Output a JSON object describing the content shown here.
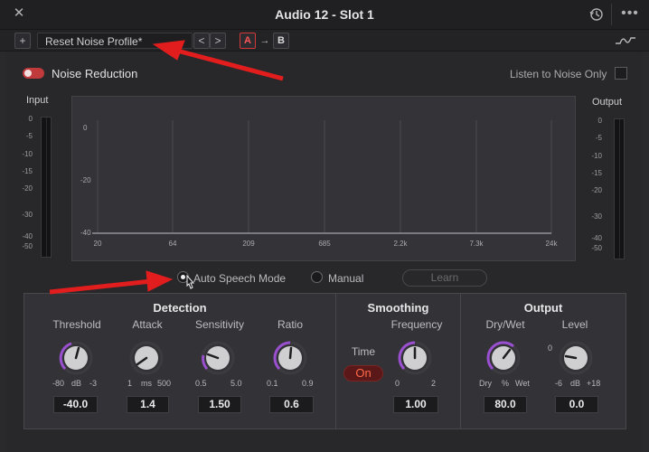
{
  "window": {
    "title": "Audio 12 - Slot 1"
  },
  "titlebar": {
    "close": "✕",
    "more": "•••"
  },
  "toolbar": {
    "add": "+",
    "preset": "Reset Noise Profile*",
    "preset_chevron": "⌄",
    "prev": "<",
    "next": ">",
    "a_label": "A",
    "copy_arrow": "→",
    "b_label": "B"
  },
  "header": {
    "noise_reduction": "Noise Reduction",
    "listen_to_noise_only": "Listen to Noise Only"
  },
  "meters": {
    "input_title": "Input",
    "output_title": "Output",
    "scale": [
      "0",
      "-5",
      "-10",
      "-15",
      "-20",
      "-30",
      "-40",
      "-50"
    ]
  },
  "graph": {
    "y_labels": [
      "0",
      "-20",
      "-40"
    ],
    "x_labels": [
      "20",
      "64",
      "209",
      "685",
      "2.2k",
      "7.3k",
      "24k"
    ]
  },
  "modes": {
    "auto_speech": "Auto Speech Mode",
    "manual": "Manual",
    "learn": "Learn",
    "selected": "auto_speech"
  },
  "detection": {
    "title": "Detection",
    "threshold": {
      "label": "Threshold",
      "min": "-80",
      "unit": "dB",
      "max": "-3",
      "value": "-40.0"
    },
    "attack": {
      "label": "Attack",
      "min": "1",
      "unit": "ms",
      "max": "500",
      "value": "1.4"
    },
    "sensitivity": {
      "label": "Sensitivity",
      "min": "0.5",
      "max": "5.0",
      "value": "1.50"
    },
    "ratio": {
      "label": "Ratio",
      "min": "0.1",
      "max": "0.9",
      "value": "0.6"
    }
  },
  "smoothing": {
    "title": "Smoothing",
    "time_label": "Time",
    "time_state": "On",
    "frequency": {
      "label": "Frequency",
      "min": "0",
      "max": "2",
      "value": "1.00"
    }
  },
  "output": {
    "title": "Output",
    "drywet": {
      "label": "Dry/Wet",
      "min": "Dry",
      "unit": "%",
      "max": "Wet",
      "value": "80.0"
    },
    "level": {
      "label": "Level",
      "zero": "0",
      "min": "-6",
      "unit": "dB",
      "max": "+18",
      "value": "0.0"
    }
  },
  "colors": {
    "accent": "#c0393b",
    "knob_arc": "#9a4fd0",
    "annotation": "#e11d1d"
  },
  "icons": {
    "history": "history-icon",
    "curve": "curve-icon",
    "close": "close-icon",
    "more": "more-icon"
  }
}
